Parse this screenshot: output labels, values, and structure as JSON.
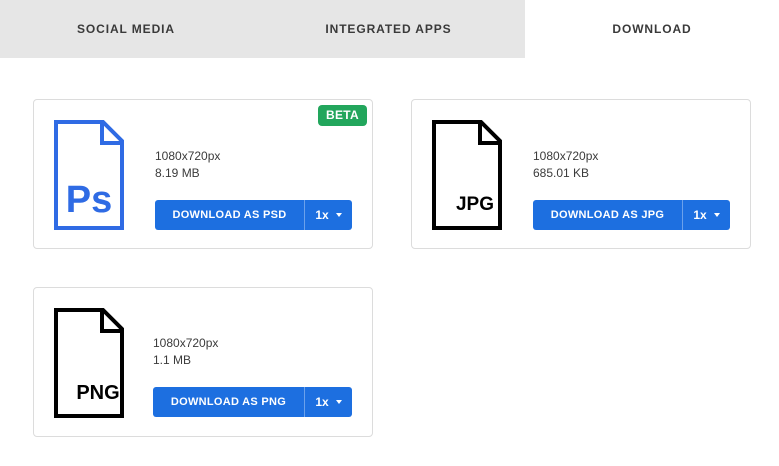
{
  "tabs": [
    {
      "label": "SOCIAL MEDIA",
      "active": false
    },
    {
      "label": "INTEGRATED APPS",
      "active": false
    },
    {
      "label": "DOWNLOAD",
      "active": true
    }
  ],
  "colors": {
    "accent": "#1d6fe0",
    "badge": "#22a65c",
    "psd_icon": "#2f6be4",
    "tab_bg": "#e6e6e6"
  },
  "downloads": {
    "psd": {
      "icon": "psd-file-icon",
      "icon_text": "Ps",
      "badge": "BETA",
      "dimensions": "1080x720px",
      "size": "8.19 MB",
      "button_label": "DOWNLOAD AS PSD",
      "scale": "1x"
    },
    "jpg": {
      "icon": "jpg-file-icon",
      "icon_text": "JPG",
      "dimensions": "1080x720px",
      "size": "685.01 KB",
      "button_label": "DOWNLOAD AS JPG",
      "scale": "1x"
    },
    "png": {
      "icon": "png-file-icon",
      "icon_text": "PNG",
      "dimensions": "1080x720px",
      "size": "1.1 MB",
      "button_label": "DOWNLOAD AS PNG",
      "scale": "1x"
    }
  }
}
